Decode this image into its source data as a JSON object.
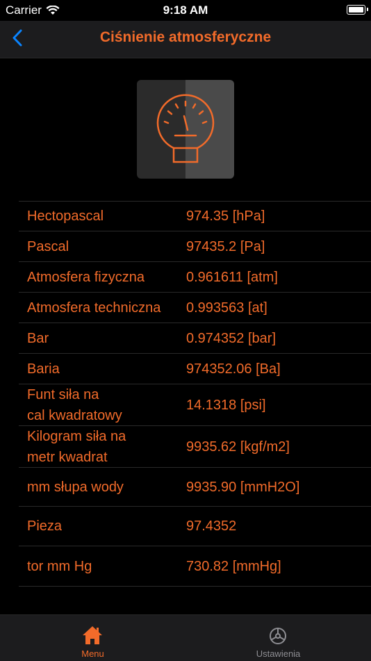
{
  "status": {
    "carrier": "Carrier",
    "time": "9:18 AM"
  },
  "nav": {
    "title": "Ciśnienie atmosferyczne",
    "back_icon": "chevron-left-icon"
  },
  "hero_icon": "pressure-gauge-icon",
  "colors": {
    "accent": "#f26b2a",
    "background": "#000000",
    "bar": "#1c1c1e"
  },
  "rows": [
    {
      "label": "Hectopascal",
      "value": "974.35 [hPa]"
    },
    {
      "label": "Pascal",
      "value": "97435.2 [Pa]"
    },
    {
      "label": "Atmosfera fizyczna",
      "value": "0.961611 [atm]"
    },
    {
      "label": "Atmosfera techniczna",
      "value": "0.993563 [at]"
    },
    {
      "label": "Bar",
      "value": "0.974352 [bar]"
    },
    {
      "label": "Baria",
      "value": "974352.06 [Ba]"
    },
    {
      "label": "Funt siła na\ncal kwadratowy",
      "value": "14.1318 [psi]"
    },
    {
      "label": "Kilogram siła na\nmetr kwadrat",
      "value": "9935.62 [kgf/m2]"
    },
    {
      "label": "mm słupa wody",
      "value": "9935.90 [mmH2O]"
    },
    {
      "label": "Pieza",
      "value": "97.4352"
    },
    {
      "label": "tor mm Hg",
      "value": "730.82 [mmHg]"
    }
  ],
  "tabs": [
    {
      "label": "Menu",
      "icon": "home-icon",
      "active": true
    },
    {
      "label": "Ustawienia",
      "icon": "settings-wheel-icon",
      "active": false
    }
  ]
}
